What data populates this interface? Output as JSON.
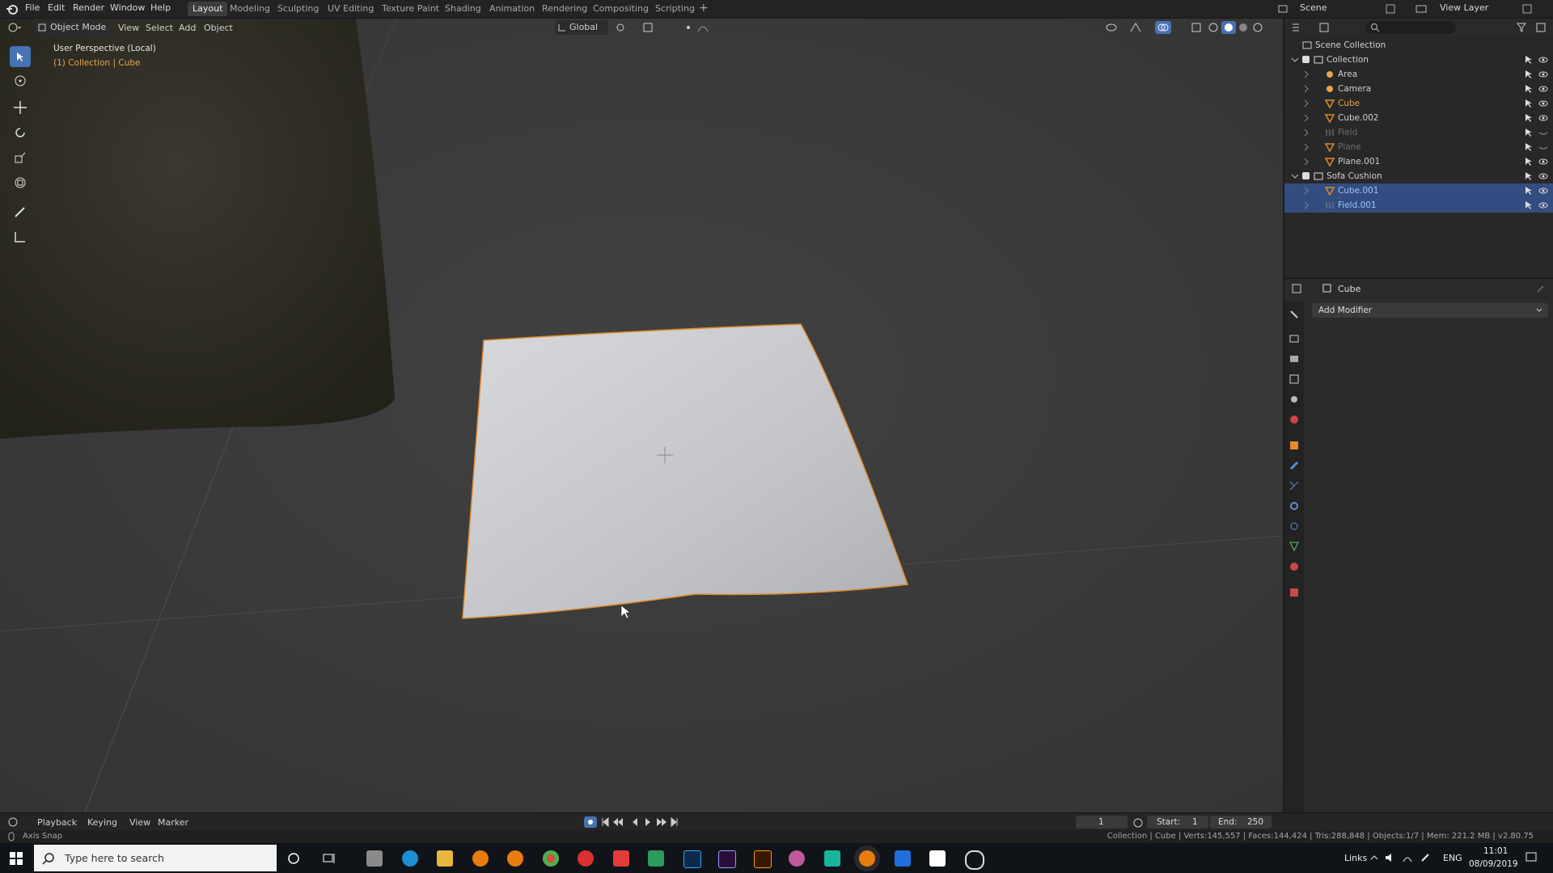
{
  "menu": [
    "File",
    "Edit",
    "Render",
    "Window",
    "Help"
  ],
  "workspaces": [
    "Layout",
    "Modeling",
    "Sculpting",
    "UV Editing",
    "Texture Paint",
    "Shading",
    "Animation",
    "Rendering",
    "Compositing",
    "Scripting"
  ],
  "scene": {
    "label": "Scene",
    "view_layer": "View Layer"
  },
  "viewport": {
    "mode": "Object Mode",
    "menus": [
      "View",
      "Select",
      "Add",
      "Object"
    ],
    "orientation": "Global",
    "perspective": "User Perspective (Local)",
    "context": "(1) Collection | Cube"
  },
  "outliner": {
    "root": "Scene Collection",
    "items": [
      {
        "label": "Collection",
        "color": "#cfcfcf"
      },
      {
        "label": "Area",
        "color": "#cfcfcf"
      },
      {
        "label": "Camera",
        "color": "#cfcfcf"
      },
      {
        "label": "Cube",
        "color": "#e8a54a"
      },
      {
        "label": "Cube.002",
        "color": "#cfcfcf"
      },
      {
        "label": "Field",
        "color": "#6e6e6e"
      },
      {
        "label": "Plane",
        "color": "#6e6e6e"
      },
      {
        "label": "Plane.001",
        "color": "#cfcfcf"
      },
      {
        "label": "Sofa Cushion",
        "color": "#cfcfcf"
      },
      {
        "label": "Cube.001",
        "color": "#9fc0ff"
      },
      {
        "label": "Field.001",
        "color": "#9fc0ff"
      }
    ]
  },
  "properties": {
    "object": "Cube",
    "add_modifier": "Add Modifier"
  },
  "timeline": {
    "menus": [
      "Playback",
      "Keying",
      "View",
      "Marker"
    ],
    "current_frame": "1",
    "start_label": "Start:",
    "start": "1",
    "end_label": "End:",
    "end": "250"
  },
  "status": {
    "left": "Axis Snap",
    "right": "Collection | Cube | Verts:145,557 | Faces:144,424 | Tris:288,848 | Objects:1/7 | Mem: 221.2 MB | v2.80.75"
  },
  "taskbar": {
    "search_placeholder": "Type here to search",
    "links": "Links",
    "lang": "ENG",
    "time": "11:01",
    "date": "08/09/2019"
  },
  "colors": {
    "accent": "#4772b3",
    "selected_object": "#e8a54a",
    "outline": "#e38a2b"
  }
}
